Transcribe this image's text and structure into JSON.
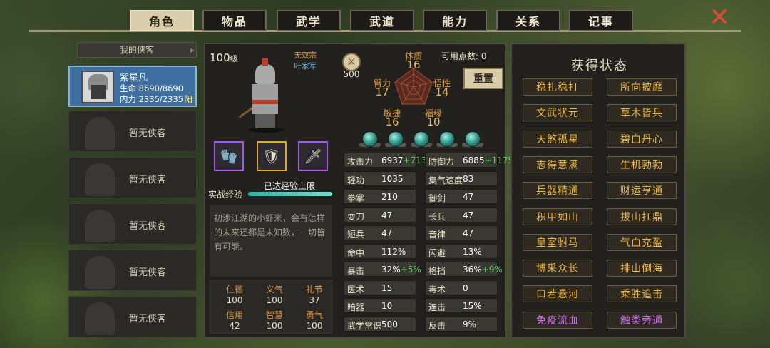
{
  "tabs": [
    {
      "label": "角色",
      "active": true
    },
    {
      "label": "物品"
    },
    {
      "label": "武学"
    },
    {
      "label": "武道"
    },
    {
      "label": "能力"
    },
    {
      "label": "关系"
    },
    {
      "label": "记事"
    }
  ],
  "left": {
    "header": "我的侠客",
    "hero": {
      "name": "紫星凡",
      "hp_label": "生命",
      "hp": "8690/8690",
      "mp_label": "内力",
      "mp": "2335/2335",
      "yin_yang": "阳"
    },
    "empty_label": "暂无侠客",
    "empty_slots": 5
  },
  "center": {
    "level": "100",
    "level_unit": "级",
    "sect": "无双宗",
    "army": "叶家军",
    "points_value": "500",
    "available_points_label": "可用点数:",
    "available_points": "0",
    "reset_label": "重置",
    "radar": [
      {
        "label": "体质",
        "value": "16"
      },
      {
        "label": "臂力",
        "value": "17"
      },
      {
        "label": "悟性",
        "value": "14"
      },
      {
        "label": "敏捷",
        "value": "16"
      },
      {
        "label": "福缘",
        "value": "10"
      }
    ],
    "exp_label": "实战经验",
    "exp_status": "已达经验上限",
    "exp_progress": 1.0,
    "description": "初涉江湖的小虾米，会有怎样的未来还都是未知数，一切皆有可能。",
    "virtues": [
      {
        "label": "仁德",
        "value": "100"
      },
      {
        "label": "义气",
        "value": "100"
      },
      {
        "label": "礼节",
        "value": "37"
      },
      {
        "label": "信用",
        "value": "42"
      },
      {
        "label": "智慧",
        "value": "100"
      },
      {
        "label": "勇气",
        "value": "100"
      }
    ],
    "stats": [
      {
        "name": "攻击力",
        "value": "6937",
        "bonus": "+713"
      },
      {
        "name": "防御力",
        "value": "6885",
        "bonus": "+1175"
      },
      {
        "name": "轻功",
        "value": "1035"
      },
      {
        "name": "集气速度",
        "value": "83"
      },
      {
        "name": "拳掌",
        "value": "210"
      },
      {
        "name": "御剑",
        "value": "47"
      },
      {
        "name": "耍刀",
        "value": "47"
      },
      {
        "name": "长兵",
        "value": "47"
      },
      {
        "name": "短兵",
        "value": "47"
      },
      {
        "name": "音律",
        "value": "47"
      },
      {
        "name": "命中",
        "value": "112%"
      },
      {
        "name": "闪避",
        "value": "13%"
      },
      {
        "name": "暴击",
        "value": "32%",
        "bonus": "+5%"
      },
      {
        "name": "格挡",
        "value": "36%",
        "bonus": "+9%"
      },
      {
        "name": "医术",
        "value": "15"
      },
      {
        "name": "毒术",
        "value": "0"
      },
      {
        "name": "暗器",
        "value": "10"
      },
      {
        "name": "连击",
        "value": "15%"
      },
      {
        "name": "武学常识",
        "value": "500"
      },
      {
        "name": "反击",
        "value": "9%"
      }
    ]
  },
  "right": {
    "title": "获得状态",
    "buffs": [
      {
        "label": "稳扎稳打"
      },
      {
        "label": "所向披靡"
      },
      {
        "label": "文武状元"
      },
      {
        "label": "草木皆兵"
      },
      {
        "label": "天煞孤星"
      },
      {
        "label": "碧血丹心"
      },
      {
        "label": "志得意满"
      },
      {
        "label": "生机勃勃"
      },
      {
        "label": "兵器精通"
      },
      {
        "label": "财运亨通"
      },
      {
        "label": "积甲如山"
      },
      {
        "label": "拔山扛鼎"
      },
      {
        "label": "皇室驸马"
      },
      {
        "label": "气血充盈"
      },
      {
        "label": "博采众长"
      },
      {
        "label": "排山倒海"
      },
      {
        "label": "口若悬河"
      },
      {
        "label": "乘胜追击"
      },
      {
        "label": "免疫流血",
        "color": "purple"
      },
      {
        "label": "触类旁通",
        "color": "purple"
      }
    ]
  },
  "colors": {
    "accent_gold": "#f0b840",
    "purple": "#d070f0",
    "bonus_green": "#5ed05e",
    "hero_blue": "#3e6fa0"
  }
}
